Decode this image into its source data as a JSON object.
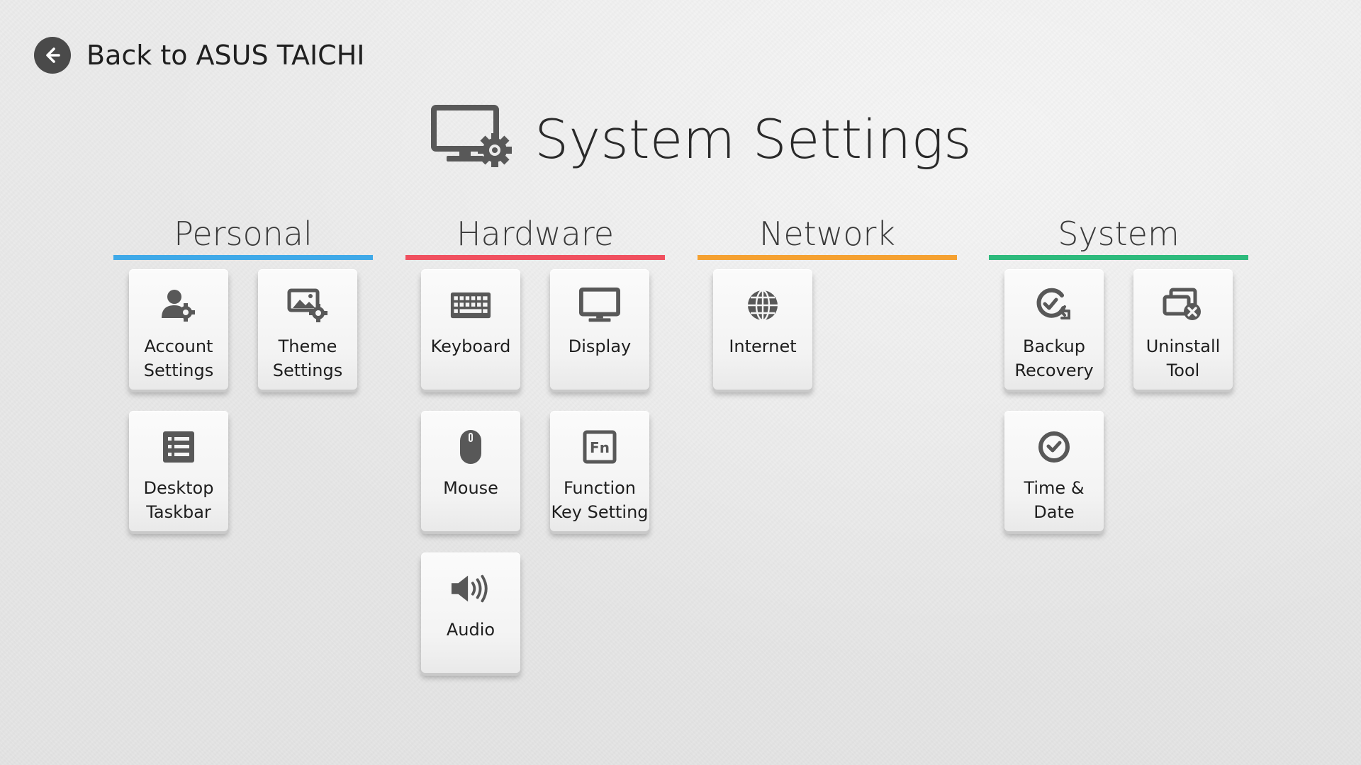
{
  "back": {
    "label": "Back to ASUS TAICHI",
    "icon": "arrow-left-icon"
  },
  "title": {
    "text": "System Settings",
    "icon": "monitor-gear-icon"
  },
  "colors": {
    "personal": "#3fa9e8",
    "hardware": "#f0505f",
    "network": "#f5a131",
    "system": "#2dba7c",
    "icon": "#585858"
  },
  "categories": {
    "personal": {
      "title": "Personal",
      "tiles": [
        {
          "label": "Account\nSettings",
          "icon": "user-gear-icon"
        },
        {
          "label": "Theme\nSettings",
          "icon": "image-gear-icon"
        },
        {
          "label": "Desktop\nTaskbar",
          "icon": "list-icon"
        }
      ]
    },
    "hardware": {
      "title": "Hardware",
      "tiles": [
        {
          "label": "Keyboard",
          "icon": "keyboard-icon"
        },
        {
          "label": "Display",
          "icon": "monitor-icon"
        },
        {
          "label": "Mouse",
          "icon": "mouse-icon"
        },
        {
          "label": "Function\nKey Setting",
          "icon": "fn-key-icon"
        },
        {
          "label": "Audio",
          "icon": "speaker-icon"
        }
      ]
    },
    "network": {
      "title": "Network",
      "tiles": [
        {
          "label": "Internet",
          "icon": "globe-icon"
        }
      ]
    },
    "system": {
      "title": "System",
      "tiles": [
        {
          "label": "Backup\nRecovery",
          "icon": "backup-icon"
        },
        {
          "label": "Uninstall\nTool",
          "icon": "uninstall-icon"
        },
        {
          "label": "Time &\nDate",
          "icon": "clock-icon"
        }
      ]
    }
  }
}
